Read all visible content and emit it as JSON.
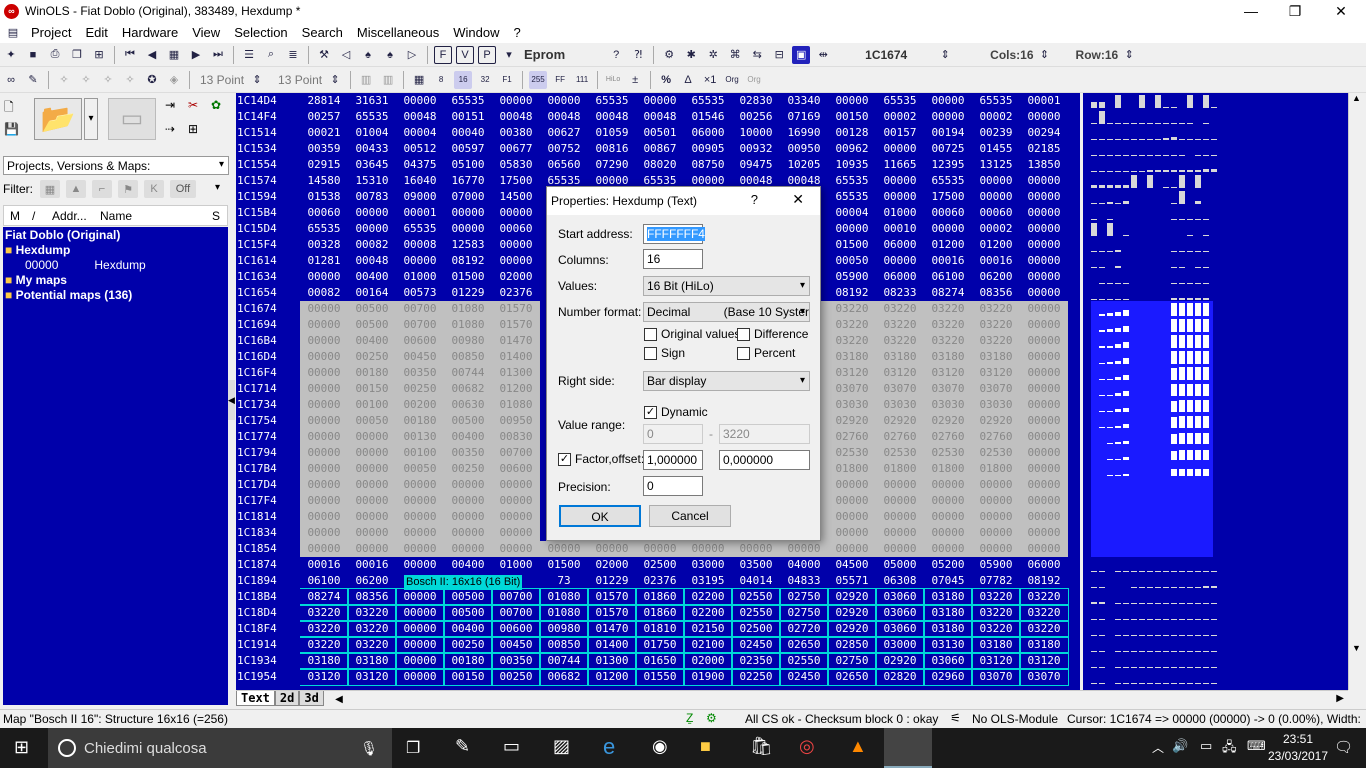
{
  "window": {
    "title": "WinOLS - Fiat Doblo (Original), 383489, Hexdump *",
    "minimize": "—",
    "restore": "❐",
    "close": "✕"
  },
  "menu": [
    "Project",
    "Edit",
    "Hardware",
    "View",
    "Selection",
    "Search",
    "Miscellaneous",
    "Window",
    "?"
  ],
  "toolbar": {
    "eprom": "Eprom",
    "address": "1C1674",
    "cols": "Cols:16",
    "row": "Row:16",
    "font1": "13 Point",
    "font2": "13 Point"
  },
  "left": {
    "dropdown": "Projects, Versions & Maps:",
    "filter_label": "Filter:",
    "filter_off": "Off",
    "col_m": "M",
    "col_slash": "/",
    "col_addr": "Addr...",
    "col_name": "Name",
    "col_s": "S",
    "tree": [
      "Fiat Doblo (Original)",
      "Hexdump",
      "00000",
      "Hexdump",
      "My maps",
      "Potential maps (136)"
    ]
  },
  "hex": {
    "addresses": [
      "1C14D4",
      "1C14F4",
      "1C1514",
      "1C1534",
      "1C1554",
      "1C1574",
      "1C1594",
      "1C15B4",
      "1C15D4",
      "1C15F4",
      "1C1614",
      "1C1634",
      "1C1654",
      "1C1674",
      "1C1694",
      "1C16B4",
      "1C16D4",
      "1C16F4",
      "1C1714",
      "1C1734",
      "1C1754",
      "1C1774",
      "1C1794",
      "1C17B4",
      "1C17D4",
      "1C17F4",
      "1C1814",
      "1C1834",
      "1C1854",
      "1C1874",
      "1C1894",
      "1C18B4",
      "1C18D4",
      "1C18F4",
      "1C1914",
      "1C1934",
      "1C1954"
    ],
    "rows": [
      [
        "28814",
        "31631",
        "00000",
        "65535",
        "00000",
        "00000",
        "65535",
        "00000",
        "65535",
        "02830",
        "03340",
        "00000",
        "65535",
        "00000",
        "65535",
        "00001"
      ],
      [
        "00257",
        "65535",
        "00048",
        "00151",
        "00048",
        "00048",
        "00048",
        "00048",
        "01546",
        "00256",
        "07169",
        "00150",
        "00002",
        "00000",
        "00002",
        "00000"
      ],
      [
        "00021",
        "01004",
        "00004",
        "00040",
        "00380",
        "00627",
        "01059",
        "00501",
        "06000",
        "10000",
        "16990",
        "00128",
        "00157",
        "00194",
        "00239",
        "00294"
      ],
      [
        "00359",
        "00433",
        "00512",
        "00597",
        "00677",
        "00752",
        "00816",
        "00867",
        "00905",
        "00932",
        "00950",
        "00962",
        "00000",
        "00725",
        "01455",
        "02185"
      ],
      [
        "02915",
        "03645",
        "04375",
        "05100",
        "05830",
        "06560",
        "07290",
        "08020",
        "08750",
        "09475",
        "10205",
        "10935",
        "11665",
        "12395",
        "13125",
        "13850"
      ],
      [
        "14580",
        "15310",
        "16040",
        "16770",
        "17500",
        "65535",
        "00000",
        "65535",
        "00000",
        "00048",
        "00048",
        "65535",
        "00000",
        "65535",
        "00000",
        "00000"
      ],
      [
        "01538",
        "00783",
        "09000",
        "07000",
        "14500",
        "",
        "",
        "",
        "",
        "",
        "06000",
        "65535",
        "00000",
        "17500",
        "00000",
        "00000"
      ],
      [
        "00060",
        "00000",
        "00001",
        "00000",
        "00000",
        "",
        "",
        "",
        "",
        "",
        "02000",
        "00004",
        "01000",
        "00060",
        "00060",
        "00000"
      ],
      [
        "65535",
        "00000",
        "65535",
        "00000",
        "00060",
        "",
        "",
        "",
        "",
        "",
        "00000",
        "00000",
        "00010",
        "00000",
        "00002",
        "00000"
      ],
      [
        "00328",
        "00082",
        "00008",
        "12583",
        "00000",
        "",
        "",
        "",
        "",
        "",
        "00900",
        "01500",
        "06000",
        "01200",
        "01200",
        "00000"
      ],
      [
        "01281",
        "00048",
        "00000",
        "08192",
        "00000",
        "",
        "",
        "",
        "",
        "",
        "00256",
        "00050",
        "00000",
        "00016",
        "00016",
        "00000"
      ],
      [
        "00000",
        "00400",
        "01000",
        "01500",
        "02000",
        "",
        "",
        "",
        "",
        "",
        "05200",
        "05900",
        "06000",
        "06100",
        "06200",
        "00000"
      ],
      [
        "00082",
        "00164",
        "00573",
        "01229",
        "02376",
        "",
        "",
        "",
        "",
        "",
        "07782",
        "08192",
        "08233",
        "08274",
        "08356",
        "00000"
      ],
      [
        "00000",
        "00500",
        "00700",
        "01080",
        "01570",
        "",
        "",
        "",
        "",
        "",
        "03180",
        "03220",
        "03220",
        "03220",
        "03220",
        "00000"
      ],
      [
        "00000",
        "00500",
        "00700",
        "01080",
        "01570",
        "",
        "",
        "",
        "",
        "",
        "03180",
        "03220",
        "03220",
        "03220",
        "03220",
        "00000"
      ],
      [
        "00000",
        "00400",
        "00600",
        "00980",
        "01470",
        "",
        "",
        "",
        "",
        "",
        "03180",
        "03220",
        "03220",
        "03220",
        "03220",
        "00000"
      ],
      [
        "00000",
        "00250",
        "00450",
        "00850",
        "01400",
        "",
        "",
        "",
        "",
        "",
        "03130",
        "03180",
        "03180",
        "03180",
        "03180",
        "00000"
      ],
      [
        "00000",
        "00180",
        "00350",
        "00744",
        "01300",
        "",
        "",
        "",
        "",
        "",
        "03060",
        "03120",
        "03120",
        "03120",
        "03120",
        "00000"
      ],
      [
        "00000",
        "00150",
        "00250",
        "00682",
        "01200",
        "",
        "",
        "",
        "",
        "",
        "02960",
        "03070",
        "03070",
        "03070",
        "03070",
        "00000"
      ],
      [
        "00000",
        "00100",
        "00200",
        "00630",
        "01080",
        "",
        "",
        "",
        "",
        "",
        "02820",
        "03030",
        "03030",
        "03030",
        "03030",
        "00000"
      ],
      [
        "00000",
        "00050",
        "00180",
        "00500",
        "00950",
        "",
        "",
        "",
        "",
        "",
        "02640",
        "02920",
        "02920",
        "02920",
        "02920",
        "00000"
      ],
      [
        "00000",
        "00000",
        "00130",
        "00400",
        "00830",
        "",
        "",
        "",
        "",
        "",
        "02450",
        "02760",
        "02760",
        "02760",
        "02760",
        "00000"
      ],
      [
        "00000",
        "00000",
        "00100",
        "00350",
        "00700",
        "",
        "",
        "",
        "",
        "",
        "02150",
        "02530",
        "02530",
        "02530",
        "02530",
        "00000"
      ],
      [
        "00000",
        "00000",
        "00050",
        "00250",
        "00600",
        "",
        "",
        "",
        "",
        "",
        "01750",
        "01800",
        "01800",
        "01800",
        "01800",
        "00000"
      ],
      [
        "00000",
        "00000",
        "00000",
        "00000",
        "00000",
        "",
        "",
        "",
        "",
        "",
        "00000",
        "00000",
        "00000",
        "00000",
        "00000",
        "00000"
      ],
      [
        "00000",
        "00000",
        "00000",
        "00000",
        "00000",
        "",
        "",
        "",
        "",
        "",
        "00000",
        "00000",
        "00000",
        "00000",
        "00000",
        "00000"
      ],
      [
        "00000",
        "00000",
        "00000",
        "00000",
        "00000",
        "",
        "",
        "",
        "",
        "",
        "00000",
        "00000",
        "00000",
        "00000",
        "00000",
        "00000"
      ],
      [
        "00000",
        "00000",
        "00000",
        "00000",
        "00000",
        "",
        "",
        "",
        "",
        "",
        "00000",
        "00000",
        "00000",
        "00000",
        "00000",
        "00000"
      ],
      [
        "00000",
        "00000",
        "00000",
        "00000",
        "00000",
        "00000",
        "00000",
        "00000",
        "00000",
        "00000",
        "00000",
        "00000",
        "00000",
        "00000",
        "00000",
        "00000"
      ],
      [
        "00016",
        "00016",
        "00000",
        "00400",
        "01000",
        "01500",
        "02000",
        "02500",
        "03000",
        "03500",
        "04000",
        "04500",
        "05000",
        "05200",
        "05900",
        "06000"
      ],
      [
        "06100",
        "06200",
        "",
        "",
        "",
        "73",
        "01229",
        "02376",
        "03195",
        "04014",
        "04833",
        "05571",
        "06308",
        "07045",
        "07782",
        "08192"
      ],
      [
        "08274",
        "08356",
        "00000",
        "00500",
        "00700",
        "01080",
        "01570",
        "01860",
        "02200",
        "02550",
        "02750",
        "02920",
        "03060",
        "03180",
        "03220",
        "03220"
      ],
      [
        "03220",
        "03220",
        "00000",
        "00500",
        "00700",
        "01080",
        "01570",
        "01860",
        "02200",
        "02550",
        "02750",
        "02920",
        "03060",
        "03180",
        "03220",
        "03220"
      ],
      [
        "03220",
        "03220",
        "00000",
        "00400",
        "00600",
        "00980",
        "01470",
        "01810",
        "02150",
        "02500",
        "02720",
        "02920",
        "03060",
        "03180",
        "03220",
        "03220"
      ],
      [
        "03220",
        "03220",
        "00000",
        "00250",
        "00450",
        "00850",
        "01400",
        "01750",
        "02100",
        "02450",
        "02650",
        "02850",
        "03000",
        "03130",
        "03180",
        "03180"
      ],
      [
        "03180",
        "03180",
        "00000",
        "00180",
        "00350",
        "00744",
        "01300",
        "01650",
        "02000",
        "02350",
        "02550",
        "02750",
        "02920",
        "03060",
        "03120",
        "03120"
      ],
      [
        "03120",
        "03120",
        "00000",
        "00150",
        "00250",
        "00682",
        "01200",
        "01550",
        "01900",
        "02250",
        "02450",
        "02650",
        "02820",
        "02960",
        "03070",
        "03070"
      ]
    ],
    "map_tooltip": "Bosch II: 16x16 (16 Bit)"
  },
  "tabs": [
    "Text",
    "2d",
    "3d"
  ],
  "status": {
    "left": "Map \"Bosch II 16\": Structure 16x16 (=256)",
    "checksum": "All CS ok - Checksum block 0 : okay",
    "module": "No OLS-Module",
    "cursor": "Cursor: 1C1674 => 00000 (00000) -> 0 (0.00%), Width: 16"
  },
  "dialog": {
    "title": "Properties: Hexdump (Text)",
    "help": "?",
    "close": "✕",
    "start_label": "Start address:",
    "start_value": "FFFFFFF4",
    "columns_label": "Columns:",
    "columns_value": "16",
    "values_label": "Values:",
    "values_value": "16 Bit (HiLo)",
    "numfmt_label": "Number format:",
    "numfmt_value": "Decimal          (Base 10 Syster",
    "orig_values": "Original values",
    "difference": "Difference",
    "sign": "Sign",
    "percent": "Percent",
    "right_label": "Right side:",
    "right_value": "Bar display",
    "dynamic": "Dynamic",
    "range_label": "Value range:",
    "range_min": "0",
    "range_dash": "-",
    "range_max": "3220",
    "factor_label": "Factor,offset:",
    "factor_value": "1,000000",
    "offset_value": "0,000000",
    "precision_label": "Precision:",
    "precision_value": "0",
    "ok": "OK",
    "cancel": "Cancel"
  },
  "taskbar": {
    "search": "Chiedimi qualcosa",
    "time": "23:51",
    "date": "23/03/2017"
  },
  "colors": {
    "blue": "#0000aa",
    "gray": "#c0c0c0",
    "accent": "#0078d7"
  }
}
